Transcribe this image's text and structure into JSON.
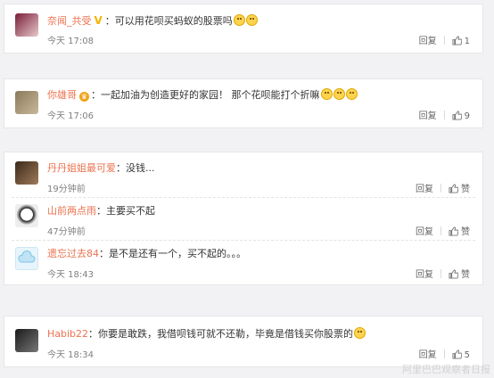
{
  "comments": [
    {
      "user": "奈闻_共受",
      "badge": "V",
      "text": "：可以用花呗买蚂蚁的股票吗",
      "emojis": 2,
      "time": "今天 17:08",
      "reply": "回复",
      "likes": "1"
    },
    {
      "user": "你雄哥",
      "badge": "👑",
      "text": "：一起加油为创造更好的家园！ 那个花呗能打个折嘛",
      "emojis": 3,
      "time": "今天 17:06",
      "reply": "回复",
      "likes": "9"
    },
    {
      "user": "丹丹姐姐最可爱",
      "text": "：没钱...",
      "time": "19分钟前",
      "reply": "回复",
      "likes": "赞"
    },
    {
      "user": "山前两点雨",
      "text": "：主要买不起",
      "time": "47分钟前",
      "reply": "回复",
      "likes": "赞"
    },
    {
      "user": "遗忘过去84",
      "text": "：是不是还有一个，买不起的。。。",
      "time": "今天 18:43",
      "reply": "回复",
      "likes": "赞"
    },
    {
      "user": "Habib22",
      "text": "：你要是敢跌，我借呗钱可就不还勒，毕竟是借钱买你股票的",
      "emojis": 1,
      "time": "今天 18:34",
      "reply": "回复",
      "likes": "5"
    }
  ],
  "watermark": "阿里巴巴观察者日报",
  "colors": {
    "username": "#eb7350",
    "time": "#808080",
    "bg": "#f2f2f5"
  }
}
